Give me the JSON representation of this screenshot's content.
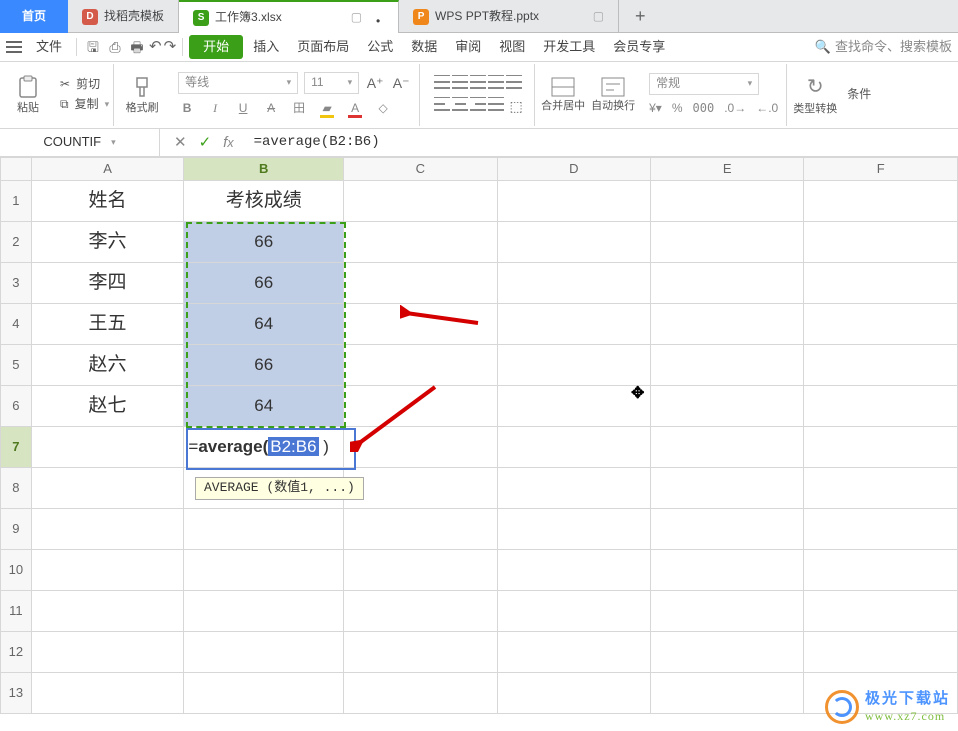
{
  "tabs": {
    "home": "首页",
    "template": "找稻壳模板",
    "workbook": {
      "label": "工作簿3.xlsx"
    },
    "ppt": {
      "label": "WPS PPT教程.pptx"
    }
  },
  "menu": {
    "file": "文件",
    "start": "开始",
    "insert": "插入",
    "layout": "页面布局",
    "formulas": "公式",
    "data": "数据",
    "review": "审阅",
    "view": "视图",
    "dev": "开发工具",
    "vip": "会员专享",
    "search": "查找命令、搜索模板"
  },
  "ribbon": {
    "paste": "粘贴",
    "cut": "剪切",
    "copy": "复制",
    "format_painter": "格式刷",
    "font": "等线",
    "size": "11",
    "merge": "合并居中",
    "wrap": "自动换行",
    "number_format": "常规",
    "type_convert": "类型转换",
    "conditional": "条件"
  },
  "formula_bar": {
    "name": "COUNTIF",
    "formula": "=average(B2:B6)"
  },
  "grid": {
    "cols": [
      "A",
      "B",
      "C",
      "D",
      "E",
      "F"
    ],
    "headers": {
      "A": "姓名",
      "B": "考核成绩"
    },
    "rows": [
      {
        "A": "李六",
        "B": "66"
      },
      {
        "A": "李四",
        "B": "66"
      },
      {
        "A": "王五",
        "B": "64"
      },
      {
        "A": "赵六",
        "B": "66"
      },
      {
        "A": "赵七",
        "B": "64"
      }
    ],
    "editing": {
      "prefix": "=",
      "fn": "average(",
      "ref": "B2:B6",
      "suffix": " )"
    },
    "tooltip": "AVERAGE (数值1, ...)"
  },
  "watermark": {
    "title": "极光下载站",
    "url": "www.xz7.com"
  }
}
